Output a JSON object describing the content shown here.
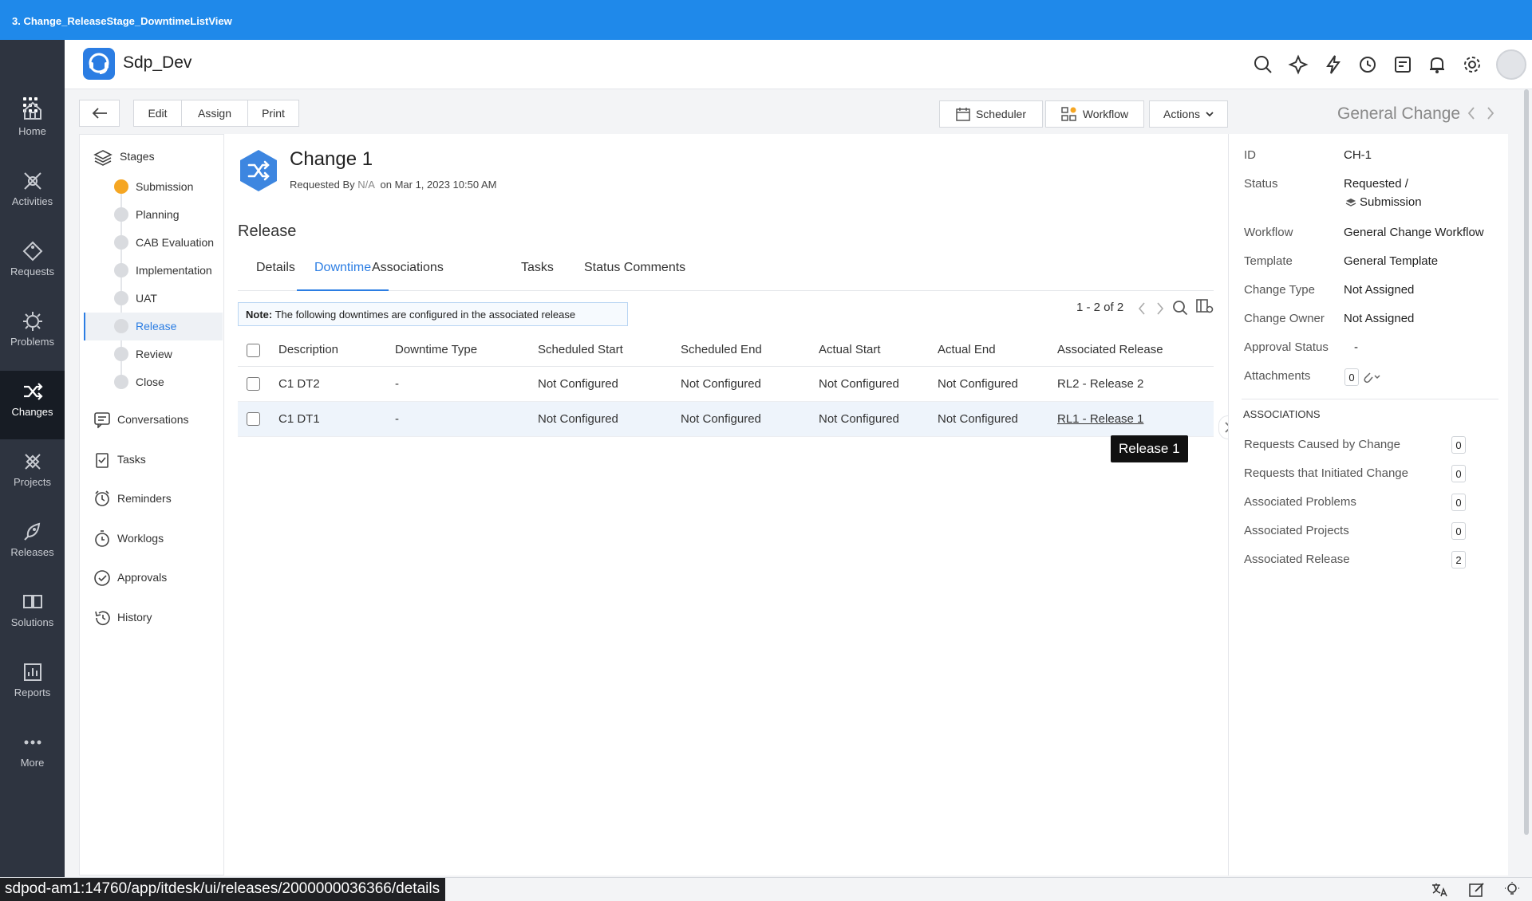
{
  "window": {
    "title": "3. Change_ReleaseStage_DowntimeListView"
  },
  "nav": {
    "items": [
      {
        "label": "Home",
        "icon": "home-icon"
      },
      {
        "label": "Activities",
        "icon": "activities-icon"
      },
      {
        "label": "Requests",
        "icon": "requests-icon"
      },
      {
        "label": "Problems",
        "icon": "problems-icon"
      },
      {
        "label": "Changes",
        "icon": "changes-icon"
      },
      {
        "label": "Projects",
        "icon": "projects-icon"
      },
      {
        "label": "Releases",
        "icon": "releases-icon"
      },
      {
        "label": "Solutions",
        "icon": "solutions-icon"
      },
      {
        "label": "Reports",
        "icon": "reports-icon"
      },
      {
        "label": "More",
        "icon": "more-icon"
      }
    ],
    "active": "Changes"
  },
  "header": {
    "app_name": "Sdp_Dev"
  },
  "toolbar": {
    "edit": "Edit",
    "assign": "Assign",
    "print": "Print",
    "scheduler": "Scheduler",
    "workflow": "Workflow",
    "actions": "Actions",
    "type_title": "General Change"
  },
  "stages": {
    "title": "Stages",
    "items": [
      "Submission",
      "Planning",
      "CAB Evaluation",
      "Implementation",
      "UAT",
      "Release",
      "Review",
      "Close"
    ],
    "current": "Submission",
    "selected": "Release"
  },
  "side_menu": [
    "Conversations",
    "Tasks",
    "Reminders",
    "Worklogs",
    "Approvals",
    "History"
  ],
  "change": {
    "title": "Change 1",
    "requested_by_label": "Requested By",
    "requested_by": "N/A",
    "requested_on": "on Mar 1, 2023 10:50 AM"
  },
  "section_title": "Release",
  "tabs": [
    "Details",
    "Downtime",
    "Associations",
    "Tasks",
    "Status Comments"
  ],
  "active_tab": "Downtime",
  "note": {
    "label": "Note:",
    "text": "The following downtimes are configured in the associated release"
  },
  "pager": {
    "text": "1 - 2 of 2"
  },
  "table": {
    "columns": [
      "Description",
      "Downtime Type",
      "Scheduled Start",
      "Scheduled End",
      "Actual Start",
      "Actual End",
      "Associated Release"
    ],
    "rows": [
      [
        "C1 DT2",
        "-",
        "Not Configured",
        "Not Configured",
        "Not Configured",
        "Not Configured",
        "RL2 - Release 2"
      ],
      [
        "C1 DT1",
        "-",
        "Not Configured",
        "Not Configured",
        "Not Configured",
        "Not Configured",
        "RL1 - Release 1"
      ]
    ]
  },
  "tooltip": "Release 1",
  "details": {
    "id_label": "ID",
    "id": "CH-1",
    "status_label": "Status",
    "status": "Requested /",
    "status_stage": "Submission",
    "workflow_label": "Workflow",
    "workflow": "General Change Workflow",
    "template_label": "Template",
    "template": "General Template",
    "change_type_label": "Change Type",
    "change_type": "Not Assigned",
    "change_owner_label": "Change Owner",
    "change_owner": "Not Assigned",
    "approval_label": "Approval Status",
    "approval": "-",
    "attachments_label": "Attachments",
    "attachments": "0"
  },
  "associations": {
    "title": "ASSOCIATIONS",
    "items": [
      {
        "label": "Requests Caused by Change",
        "count": "0"
      },
      {
        "label": "Requests that Initiated Change",
        "count": "0"
      },
      {
        "label": "Associated Problems",
        "count": "0"
      },
      {
        "label": "Associated Projects",
        "count": "0"
      },
      {
        "label": "Associated Release",
        "count": "2"
      }
    ]
  },
  "status_url": "sdpod-am1:14760/app/itdesk/ui/releases/2000000036366/details",
  "colors": {
    "accent": "#2b7de3",
    "titlebar": "#1f89ea",
    "nav_bg": "#2e3440",
    "stage_current": "#f5a623"
  }
}
